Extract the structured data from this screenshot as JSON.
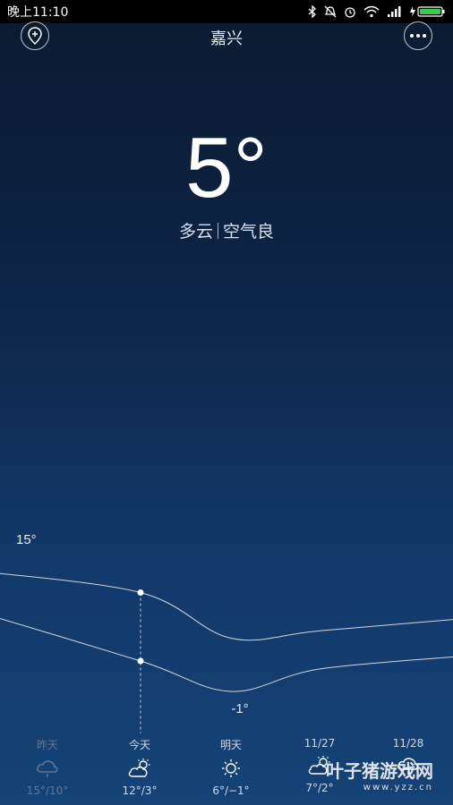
{
  "status_bar": {
    "time": "晚上11:10"
  },
  "header": {
    "city": "嘉兴"
  },
  "current": {
    "temperature": "5°",
    "condition": "多云",
    "air_quality": "空气良"
  },
  "chart_data": {
    "type": "line",
    "categories": [
      "昨天",
      "今天",
      "明天",
      "11/27",
      "11/28"
    ],
    "series": [
      {
        "values": [
          15,
          12,
          6,
          7,
          9
        ]
      },
      {
        "values": [
          10,
          3,
          -1,
          2,
          4
        ]
      }
    ],
    "ylim": [
      -3,
      17
    ],
    "labels": {
      "high": "15°",
      "low": "-1°"
    }
  },
  "forecast": [
    {
      "label": "昨天",
      "icon": "cloud-rain-icon",
      "range": "15°/10°"
    },
    {
      "label": "今天",
      "icon": "cloud-sun-icon",
      "range": "12°/3°"
    },
    {
      "label": "明天",
      "icon": "sun-icon",
      "range": "6°/−1°"
    },
    {
      "label": "11/27",
      "icon": "cloud-sun-icon",
      "range": "7°/2°"
    },
    {
      "label": "11/28",
      "icon": "cloud-rain-icon",
      "range": ""
    }
  ],
  "watermark": {
    "brand": "叶子猪游戏网",
    "url": "www.yzz.cn"
  }
}
